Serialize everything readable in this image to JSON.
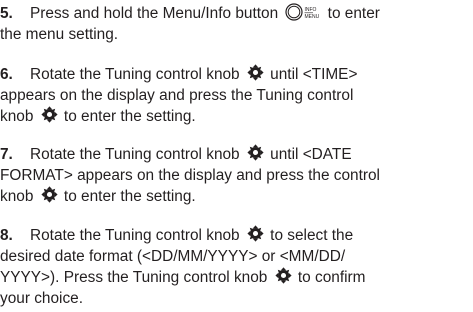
{
  "steps": [
    {
      "number": "5.",
      "line1_a": "Press and hold the Menu/Info button",
      "line1_b": "to enter",
      "line2": "the menu setting.",
      "menu_icon_label_top": "INFO",
      "menu_icon_label_bottom": "MENU"
    },
    {
      "number": "6.",
      "line1_a": "Rotate the Tuning control knob",
      "line1_b": "until <TIME>",
      "line2": "appears on the display and press the Tuning control",
      "line3_a": "knob",
      "line3_b": "to enter the setting."
    },
    {
      "number": "7.",
      "line1_a": "Rotate the Tuning control knob",
      "line1_b": "until <DATE",
      "line2": "FORMAT> appears on the display and press the control",
      "line3_a": "knob",
      "line3_b": "to enter the setting."
    },
    {
      "number": "8.",
      "line1_a": "Rotate the Tuning control knob",
      "line1_b": "to select the",
      "line2": "desired date format (<DD/MM/YYYY> or <MM/DD/",
      "line3_a": "YYYY>). Press the Tuning control knob",
      "line3_b": "to confirm",
      "line4": "your choice."
    }
  ],
  "icons": {
    "knob": "tuning-knob-icon",
    "menu": "menu-info-button-icon"
  }
}
